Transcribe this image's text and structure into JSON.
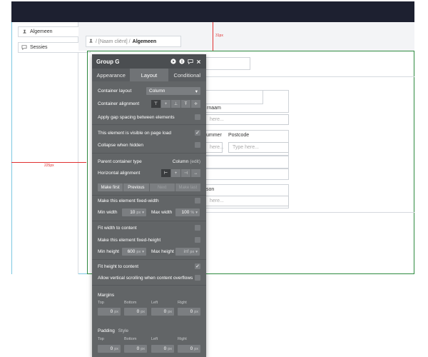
{
  "sidebar": {
    "items": [
      {
        "label": "Algemeen",
        "icon": "pin-icon"
      },
      {
        "label": "Sessies",
        "icon": "chat-icon"
      }
    ]
  },
  "breadcrumb": {
    "parent": "/ [Naam cliënt] /",
    "current": "Algemeen"
  },
  "guides": {
    "vertical_label": "31px",
    "horizontal_label": "225px"
  },
  "form": {
    "label_achternaam": "rnaam",
    "label_nummer": "ummer",
    "label_postcode": "Postcode",
    "label_woonplaats": "son",
    "placeholder_short": "here...",
    "placeholder_full": "Type here..."
  },
  "panel": {
    "title": "Group G",
    "tabs": [
      "Appearance",
      "Layout",
      "Conditional"
    ],
    "active_tab": "Layout",
    "container_layout_label": "Container layout",
    "container_layout_value": "Column",
    "container_alignment_label": "Container alignment",
    "gap_spacing_label": "Apply gap spacing between elements",
    "visible_on_load_label": "This element is visible on page load",
    "collapse_hidden_label": "Collapse when hidden",
    "parent_type_label": "Parent container type",
    "parent_type_value": "Column",
    "parent_type_edit": "(edit)",
    "horizontal_alignment_label": "Horizontal alignment",
    "order_buttons": [
      "Make first",
      "Previous",
      "Next",
      "Make last"
    ],
    "fixed_width_label": "Make this element fixed-width",
    "min_width_label": "Min width",
    "min_width_value": "10",
    "min_width_unit": "px",
    "max_width_label": "Max width",
    "max_width_value": "100",
    "max_width_unit": "%",
    "fit_width_label": "Fit width to content",
    "fixed_height_label": "Make this element fixed-height",
    "min_height_label": "Min height",
    "min_height_value": "600",
    "min_height_unit": "px",
    "max_height_label": "Max height",
    "max_height_value": "inf",
    "max_height_unit": "px",
    "fit_height_label": "Fit height to content",
    "vertical_scroll_label": "Allow vertical scrolling when content overflows",
    "margins_label": "Margins",
    "padding_label": "Padding",
    "padding_style": "Style",
    "side_labels": [
      "Top",
      "Bottom",
      "Left",
      "Right"
    ],
    "side_value": "0",
    "side_unit": "px"
  },
  "colors": {
    "topbar": "#1d2030",
    "panel": "#626567",
    "panel_header": "#4b4e51",
    "guide_red": "#e03030",
    "page_outline": "#7cc9e2",
    "group_outline": "#2d8a3f"
  }
}
